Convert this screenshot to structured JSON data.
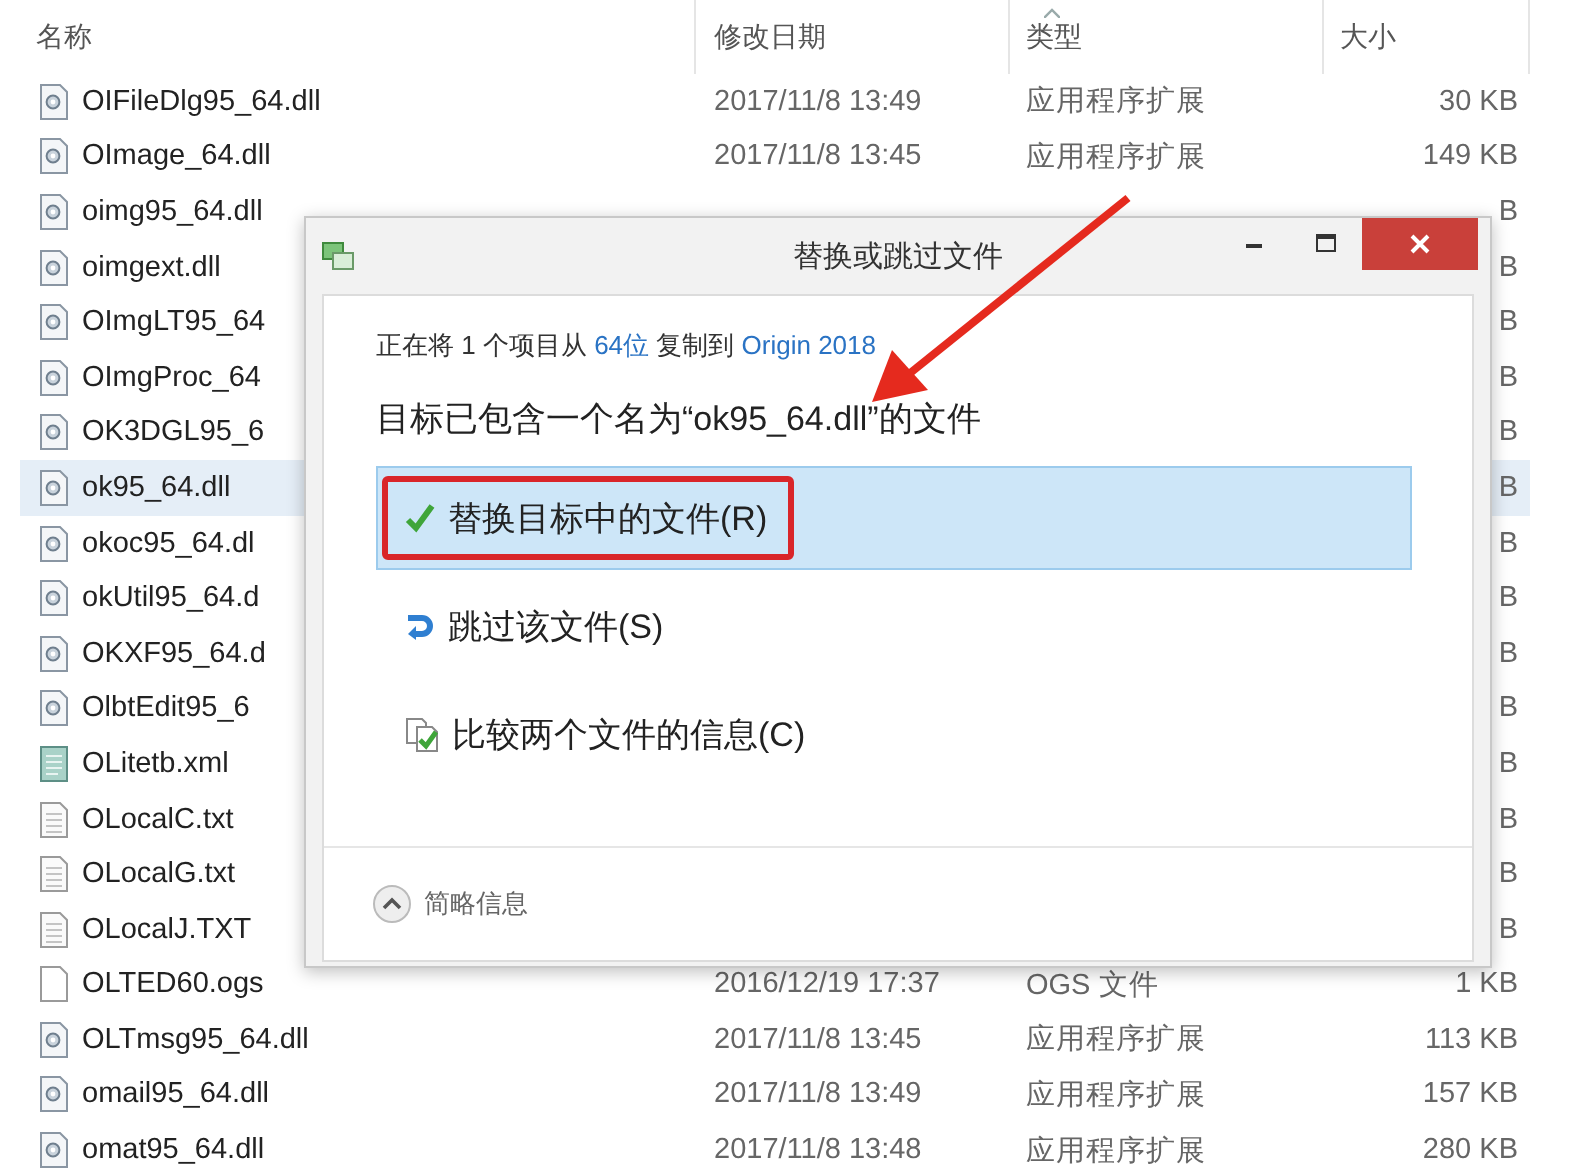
{
  "file_list": {
    "columns": [
      {
        "label": "名称"
      },
      {
        "label": "修改日期"
      },
      {
        "label": "类型"
      },
      {
        "label": "大小"
      }
    ],
    "rows": [
      {
        "kind": "dll",
        "name": "OIFileDlg95_64.dll",
        "date": "2017/11/8 13:49",
        "type": "应用程序扩展",
        "size": "30 KB",
        "selected": false
      },
      {
        "kind": "dll",
        "name": "OImage_64.dll",
        "date": "2017/11/8 13:45",
        "type": "应用程序扩展",
        "size": "149 KB",
        "selected": false
      },
      {
        "kind": "dll",
        "name": "oimg95_64.dll",
        "size": "B",
        "selected": false
      },
      {
        "kind": "dll",
        "name": "oimgext.dll",
        "size": "B",
        "selected": false
      },
      {
        "kind": "dll",
        "name": "OImgLT95_64",
        "size": "B",
        "selected": false
      },
      {
        "kind": "dll",
        "name": "OImgProc_64",
        "size": "B",
        "selected": false
      },
      {
        "kind": "dll",
        "name": "OK3DGL95_6",
        "size": "B",
        "selected": false
      },
      {
        "kind": "dll",
        "name": "ok95_64.dll",
        "size": "B",
        "selected": true
      },
      {
        "kind": "dll",
        "name": "okoc95_64.dl",
        "size": "B",
        "selected": false
      },
      {
        "kind": "dll",
        "name": "okUtil95_64.d",
        "size": "B",
        "selected": false
      },
      {
        "kind": "dll",
        "name": "OKXF95_64.d",
        "size": "B",
        "selected": false
      },
      {
        "kind": "dll",
        "name": "OlbtEdit95_6",
        "size": "B",
        "selected": false
      },
      {
        "kind": "xml",
        "name": "OLitetb.xml",
        "size": "B",
        "selected": false
      },
      {
        "kind": "txt",
        "name": "OLocalC.txt",
        "size": "B",
        "selected": false
      },
      {
        "kind": "txt",
        "name": "OLocalG.txt",
        "size": "B",
        "selected": false
      },
      {
        "kind": "txt",
        "name": "OLocalJ.TXT",
        "size": "B",
        "selected": false
      },
      {
        "kind": "file",
        "name": "OLTED60.ogs",
        "date": "2016/12/19 17:37",
        "type": "OGS 文件",
        "size": "1 KB",
        "selected": false
      },
      {
        "kind": "dll",
        "name": "OLTmsg95_64.dll",
        "date": "2017/11/8 13:45",
        "type": "应用程序扩展",
        "size": "113 KB",
        "selected": false
      },
      {
        "kind": "dll",
        "name": "omail95_64.dll",
        "date": "2017/11/8 13:49",
        "type": "应用程序扩展",
        "size": "157 KB",
        "selected": false
      },
      {
        "kind": "dll",
        "name": "omat95_64.dll",
        "date": "2017/11/8 13:48",
        "type": "应用程序扩展",
        "size": "280 KB",
        "selected": false
      }
    ]
  },
  "dialog": {
    "title": "替换或跳过文件",
    "status_line": [
      {
        "kind": "text",
        "text": "正在将 1 个项目从 "
      },
      {
        "kind": "link",
        "text": "64位"
      },
      {
        "kind": "text",
        "text": " 复制到 "
      },
      {
        "kind": "link",
        "text": "Origin 2018"
      }
    ],
    "heading": "目标已包含一个名为“ok95_64.dll”的文件",
    "options": [
      {
        "kind": "replace",
        "label": "替换目标中的文件(R)",
        "selected": true,
        "annotated": true
      },
      {
        "kind": "skip",
        "label": "跳过该文件(S)",
        "selected": false,
        "annotated": false
      },
      {
        "kind": "compare",
        "label": "比较两个文件的信息(C)",
        "selected": false,
        "annotated": false
      }
    ],
    "details_toggle": {
      "label": "简略信息",
      "expanded": true
    }
  }
}
